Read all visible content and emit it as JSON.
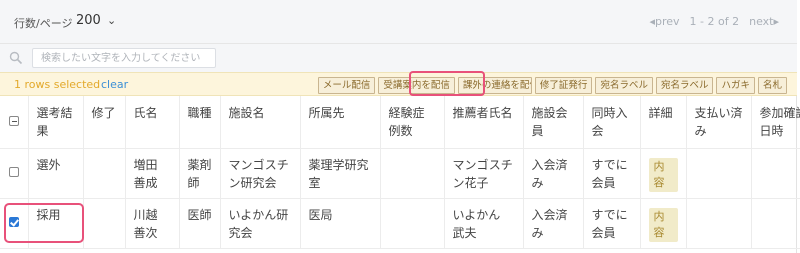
{
  "toolbar": {
    "per_page_label": "行数/ページ",
    "per_page_value": "200",
    "pager": {
      "prev": "prev",
      "range": "1 - 2 of 2",
      "next": "next"
    }
  },
  "search": {
    "placeholder": "検索したい文字を入力してください"
  },
  "selection": {
    "count_text": "1 rows selected",
    "clear": "clear",
    "actions": [
      "メール配信",
      "受講案内を配信",
      "課外の連絡を配信",
      "修了証発行",
      "宛名ラベル",
      "宛名ラベル",
      "ハガキ",
      "名札"
    ]
  },
  "table": {
    "headers": [
      "選考結果",
      "修了",
      "氏名",
      "職種",
      "施設名",
      "所属先",
      "経験症例数",
      "推薦者氏名",
      "施設会員",
      "同時入会",
      "詳細",
      "支払い済み",
      "参加確認日時"
    ],
    "rows": [
      {
        "selected": false,
        "cells": [
          "選外",
          "",
          "増田 善成",
          "薬剤師",
          "マンゴスチン研究会",
          "薬理学研究室",
          "",
          "マンゴスチン花子",
          "入会済み",
          "すでに会員",
          "内容",
          "",
          ""
        ]
      },
      {
        "selected": true,
        "cells": [
          "採用",
          "",
          "川越 善次",
          "医師",
          "いよかん研究会",
          "医局",
          "",
          "いよかん 武夫",
          "入会済み",
          "すでに会員",
          "内容",
          "",
          ""
        ]
      }
    ]
  },
  "colors": {
    "accent": "#2a78d6",
    "highlight": "#e8517a",
    "selection_bg": "#fdf5dc",
    "selection_text": "#e3a92b"
  }
}
